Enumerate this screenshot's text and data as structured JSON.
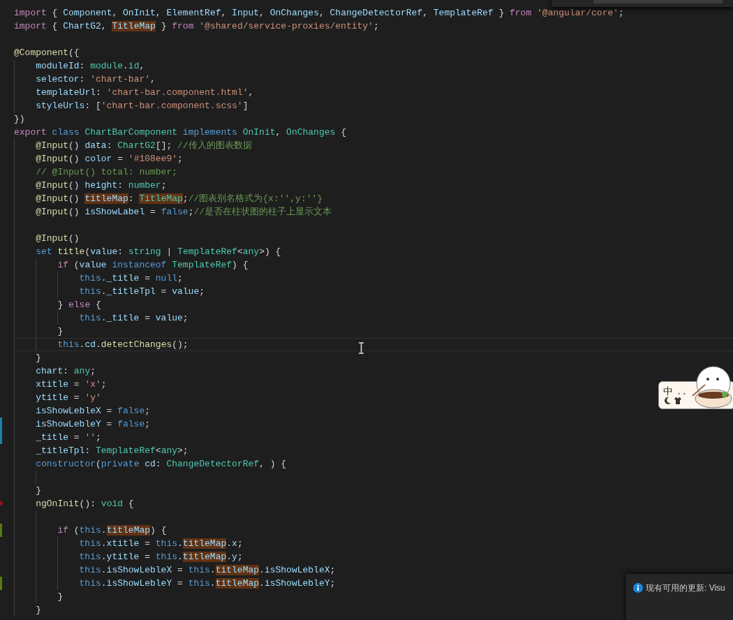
{
  "editor": {
    "lines": [
      {
        "current": false,
        "tokens": [
          {
            "text": "import",
            "kind": "keyword"
          },
          {
            "text": " { ",
            "kind": "plain"
          },
          {
            "text": "Component",
            "kind": "variable"
          },
          {
            "text": ", ",
            "kind": "plain"
          },
          {
            "text": "OnInit",
            "kind": "variable"
          },
          {
            "text": ", ",
            "kind": "plain"
          },
          {
            "text": "ElementRef",
            "kind": "variable"
          },
          {
            "text": ", ",
            "kind": "plain"
          },
          {
            "text": "Input",
            "kind": "variable"
          },
          {
            "text": ", ",
            "kind": "plain"
          },
          {
            "text": "OnChanges",
            "kind": "variable"
          },
          {
            "text": ", ",
            "kind": "plain"
          },
          {
            "text": "ChangeDetectorRef",
            "kind": "variable"
          },
          {
            "text": ", ",
            "kind": "plain"
          },
          {
            "text": "TemplateRef",
            "kind": "variable"
          },
          {
            "text": " } ",
            "kind": "plain"
          },
          {
            "text": "from ",
            "kind": "keyword"
          },
          {
            "text": "'@angular/core'",
            "kind": "string"
          },
          {
            "text": ";",
            "kind": "plain"
          }
        ]
      },
      {
        "current": false,
        "tokens": [
          {
            "text": "import",
            "kind": "keyword"
          },
          {
            "text": " { ",
            "kind": "plain"
          },
          {
            "text": "ChartG2",
            "kind": "variable"
          },
          {
            "text": ", ",
            "kind": "plain"
          },
          {
            "text": "TitleMap",
            "kind": "match"
          },
          {
            "text": " } ",
            "kind": "plain"
          },
          {
            "text": "from ",
            "kind": "keyword"
          },
          {
            "text": "'@shared/service-proxies/entity'",
            "kind": "string"
          },
          {
            "text": ";",
            "kind": "plain"
          }
        ]
      },
      {
        "current": false
      },
      {
        "current": false,
        "tokens": [
          {
            "text": "@Component",
            "kind": "function"
          },
          {
            "text": "({",
            "kind": "plain"
          }
        ],
        "children": [
          {
            "current": false,
            "tokens": [
              {
                "text": "moduleId",
                "kind": "variable"
              },
              {
                "text": ": ",
                "kind": "plain"
              },
              {
                "text": "module",
                "kind": "type"
              },
              {
                "text": ".",
                "kind": "plain"
              },
              {
                "text": "id",
                "kind": "type"
              },
              {
                "text": ",",
                "kind": "plain"
              }
            ]
          },
          {
            "current": false,
            "tokens": [
              {
                "text": "selector",
                "kind": "variable"
              },
              {
                "text": ": ",
                "kind": "plain"
              },
              {
                "text": "'chart-bar'",
                "kind": "string"
              },
              {
                "text": ",",
                "kind": "plain"
              }
            ]
          },
          {
            "current": false,
            "tokens": [
              {
                "text": "templateUrl",
                "kind": "variable"
              },
              {
                "text": ": ",
                "kind": "plain"
              },
              {
                "text": "'chart-bar.component.html'",
                "kind": "string"
              },
              {
                "text": ",",
                "kind": "plain"
              }
            ]
          },
          {
            "current": false,
            "tokens": [
              {
                "text": "styleUrls",
                "kind": "variable"
              },
              {
                "text": ": [",
                "kind": "plain"
              },
              {
                "text": "'chart-bar.component.scss'",
                "kind": "string"
              },
              {
                "text": "]",
                "kind": "plain"
              }
            ]
          }
        ]
      },
      {
        "current": false,
        "tokens": [
          {
            "text": "})",
            "kind": "plain"
          }
        ]
      },
      {
        "current": false,
        "tokens": [
          {
            "text": "export ",
            "kind": "keyword"
          },
          {
            "text": "class ",
            "kind": "storage"
          },
          {
            "text": "ChartBarComponent ",
            "kind": "type"
          },
          {
            "text": "implements ",
            "kind": "storage"
          },
          {
            "text": "OnInit",
            "kind": "type"
          },
          {
            "text": ", ",
            "kind": "plain"
          },
          {
            "text": "OnChanges",
            "kind": "type"
          },
          {
            "text": " {",
            "kind": "plain"
          }
        ],
        "children": [
          {
            "current": false,
            "tokens": [
              {
                "text": "@Input",
                "kind": "function"
              },
              {
                "text": "() ",
                "kind": "plain"
              },
              {
                "text": "data",
                "kind": "variable"
              },
              {
                "text": ": ",
                "kind": "plain"
              },
              {
                "text": "ChartG2",
                "kind": "type"
              },
              {
                "text": "[]; ",
                "kind": "plain"
              },
              {
                "text": "//传入的图表数据",
                "kind": "comment"
              }
            ]
          },
          {
            "current": false,
            "tokens": [
              {
                "text": "@Input",
                "kind": "function"
              },
              {
                "text": "() ",
                "kind": "plain"
              },
              {
                "text": "color",
                "kind": "variable"
              },
              {
                "text": " = ",
                "kind": "plain"
              },
              {
                "text": "'#108ee9'",
                "kind": "string"
              },
              {
                "text": ";",
                "kind": "plain"
              }
            ]
          },
          {
            "current": false,
            "tokens": [
              {
                "text": "// @Input() total: number;",
                "kind": "comment"
              }
            ]
          },
          {
            "current": false,
            "tokens": [
              {
                "text": "@Input",
                "kind": "function"
              },
              {
                "text": "() ",
                "kind": "plain"
              },
              {
                "text": "height",
                "kind": "variable"
              },
              {
                "text": ": ",
                "kind": "plain"
              },
              {
                "text": "number",
                "kind": "type"
              },
              {
                "text": ";",
                "kind": "plain"
              }
            ]
          },
          {
            "current": false,
            "tokens": [
              {
                "text": "@Input",
                "kind": "function"
              },
              {
                "text": "() ",
                "kind": "plain"
              },
              {
                "text": "titleMap",
                "kind": "match"
              },
              {
                "text": ": ",
                "kind": "plain"
              },
              {
                "text": "TitleMap",
                "kind": "matchtype"
              },
              {
                "text": ";",
                "kind": "plain"
              },
              {
                "text": "//图表别名格式为{x:'',y:''}",
                "kind": "comment"
              }
            ]
          },
          {
            "current": false,
            "tokens": [
              {
                "text": "@Input",
                "kind": "function"
              },
              {
                "text": "() ",
                "kind": "plain"
              },
              {
                "text": "isShowLabel",
                "kind": "variable"
              },
              {
                "text": " = ",
                "kind": "plain"
              },
              {
                "text": "false",
                "kind": "storage"
              },
              {
                "text": ";",
                "kind": "plain"
              },
              {
                "text": "//是否在柱状图的柱子上显示文本",
                "kind": "comment"
              }
            ]
          },
          {
            "current": false
          },
          {
            "current": false,
            "tokens": [
              {
                "text": "@Input",
                "kind": "function"
              },
              {
                "text": "()",
                "kind": "plain"
              }
            ]
          },
          {
            "current": false,
            "tokens": [
              {
                "text": "set ",
                "kind": "storage"
              },
              {
                "text": "title",
                "kind": "function"
              },
              {
                "text": "(",
                "kind": "plain"
              },
              {
                "text": "value",
                "kind": "variable"
              },
              {
                "text": ": ",
                "kind": "plain"
              },
              {
                "text": "string",
                "kind": "type"
              },
              {
                "text": " | ",
                "kind": "plain"
              },
              {
                "text": "TemplateRef",
                "kind": "type"
              },
              {
                "text": "<",
                "kind": "plain"
              },
              {
                "text": "any",
                "kind": "type"
              },
              {
                "text": ">) {",
                "kind": "plain"
              }
            ],
            "children": [
              {
                "current": false,
                "tokens": [
                  {
                    "text": "if",
                    "kind": "keyword"
                  },
                  {
                    "text": " (",
                    "kind": "plain"
                  },
                  {
                    "text": "value ",
                    "kind": "variable"
                  },
                  {
                    "text": "instanceof ",
                    "kind": "storage"
                  },
                  {
                    "text": "TemplateRef",
                    "kind": "type"
                  },
                  {
                    "text": ") {",
                    "kind": "plain"
                  }
                ],
                "children": [
                  {
                    "current": false,
                    "tokens": [
                      {
                        "text": "this",
                        "kind": "storage"
                      },
                      {
                        "text": ".",
                        "kind": "plain"
                      },
                      {
                        "text": "_title",
                        "kind": "variable"
                      },
                      {
                        "text": " = ",
                        "kind": "plain"
                      },
                      {
                        "text": "null",
                        "kind": "storage"
                      },
                      {
                        "text": ";",
                        "kind": "plain"
                      }
                    ]
                  },
                  {
                    "current": false,
                    "tokens": [
                      {
                        "text": "this",
                        "kind": "storage"
                      },
                      {
                        "text": ".",
                        "kind": "plain"
                      },
                      {
                        "text": "_titleTpl",
                        "kind": "variable"
                      },
                      {
                        "text": " = ",
                        "kind": "plain"
                      },
                      {
                        "text": "value",
                        "kind": "variable"
                      },
                      {
                        "text": ";",
                        "kind": "plain"
                      }
                    ]
                  }
                ]
              },
              {
                "current": false,
                "tokens": [
                  {
                    "text": "} ",
                    "kind": "plain"
                  },
                  {
                    "text": "else",
                    "kind": "keyword"
                  },
                  {
                    "text": " {",
                    "kind": "plain"
                  }
                ],
                "children": [
                  {
                    "current": false,
                    "tokens": [
                      {
                        "text": "this",
                        "kind": "storage"
                      },
                      {
                        "text": ".",
                        "kind": "plain"
                      },
                      {
                        "text": "_title",
                        "kind": "variable"
                      },
                      {
                        "text": " = ",
                        "kind": "plain"
                      },
                      {
                        "text": "value",
                        "kind": "variable"
                      },
                      {
                        "text": ";",
                        "kind": "plain"
                      }
                    ]
                  }
                ]
              },
              {
                "current": false,
                "tokens": [
                  {
                    "text": "}",
                    "kind": "plain"
                  }
                ]
              },
              {
                "current": true,
                "tokens": [
                  {
                    "text": "this",
                    "kind": "storage"
                  },
                  {
                    "text": ".",
                    "kind": "plain"
                  },
                  {
                    "text": "cd",
                    "kind": "variable"
                  },
                  {
                    "text": ".",
                    "kind": "plain"
                  },
                  {
                    "text": "detectChanges",
                    "kind": "function"
                  },
                  {
                    "text": "();",
                    "kind": "plain"
                  }
                ]
              }
            ]
          },
          {
            "current": false,
            "tokens": [
              {
                "text": "}",
                "kind": "plain"
              }
            ]
          },
          {
            "current": false,
            "tokens": [
              {
                "text": "chart",
                "kind": "variable"
              },
              {
                "text": ": ",
                "kind": "plain"
              },
              {
                "text": "any",
                "kind": "type"
              },
              {
                "text": ";",
                "kind": "plain"
              }
            ]
          },
          {
            "current": false,
            "tokens": [
              {
                "text": "xtitle",
                "kind": "variable"
              },
              {
                "text": " = ",
                "kind": "plain"
              },
              {
                "text": "'x'",
                "kind": "string"
              },
              {
                "text": ";",
                "kind": "plain"
              }
            ]
          },
          {
            "current": false,
            "tokens": [
              {
                "text": "ytitle",
                "kind": "variable"
              },
              {
                "text": " = ",
                "kind": "plain"
              },
              {
                "text": "'y'",
                "kind": "string"
              }
            ]
          },
          {
            "current": false,
            "tokens": [
              {
                "text": "isShowLebleX",
                "kind": "variable"
              },
              {
                "text": " = ",
                "kind": "plain"
              },
              {
                "text": "false",
                "kind": "storage"
              },
              {
                "text": ";",
                "kind": "plain"
              }
            ]
          },
          {
            "gutter": {
              "kind": "modified"
            },
            "current": false,
            "tokens": [
              {
                "text": "isShowLebleY",
                "kind": "variable"
              },
              {
                "text": " = ",
                "kind": "plain"
              },
              {
                "text": "false",
                "kind": "storage"
              },
              {
                "text": ";",
                "kind": "plain"
              }
            ]
          },
          {
            "gutter": {
              "kind": "modified"
            },
            "current": false,
            "tokens": [
              {
                "text": "_title",
                "kind": "variable"
              },
              {
                "text": " = ",
                "kind": "plain"
              },
              {
                "text": "''",
                "kind": "string"
              },
              {
                "text": ";",
                "kind": "plain"
              }
            ]
          },
          {
            "current": false,
            "tokens": [
              {
                "text": "_titleTpl",
                "kind": "variable"
              },
              {
                "text": ": ",
                "kind": "plain"
              },
              {
                "text": "TemplateRef",
                "kind": "type"
              },
              {
                "text": "<",
                "kind": "plain"
              },
              {
                "text": "any",
                "kind": "type"
              },
              {
                "text": ">;",
                "kind": "plain"
              }
            ]
          },
          {
            "current": false,
            "tokens": [
              {
                "text": "constructor",
                "kind": "storage"
              },
              {
                "text": "(",
                "kind": "plain"
              },
              {
                "text": "private ",
                "kind": "storage"
              },
              {
                "text": "cd",
                "kind": "variable"
              },
              {
                "text": ": ",
                "kind": "plain"
              },
              {
                "text": "ChangeDetectorRef",
                "kind": "type"
              },
              {
                "text": ", ) {",
                "kind": "plain"
              }
            ],
            "children": [
              {
                "current": false
              }
            ]
          },
          {
            "current": false,
            "tokens": [
              {
                "text": "}",
                "kind": "plain"
              }
            ]
          },
          {
            "gutter": {
              "kind": "deleted"
            },
            "current": false,
            "tokens": [
              {
                "text": "ngOnInit",
                "kind": "function"
              },
              {
                "text": "(): ",
                "kind": "plain"
              },
              {
                "text": "void",
                "kind": "type"
              },
              {
                "text": " {",
                "kind": "plain"
              }
            ],
            "children": [
              {
                "current": false
              },
              {
                "gutter": {
                  "kind": "added"
                },
                "current": false,
                "tokens": [
                  {
                    "text": "if",
                    "kind": "keyword"
                  },
                  {
                    "text": " (",
                    "kind": "plain"
                  },
                  {
                    "text": "this",
                    "kind": "storage"
                  },
                  {
                    "text": ".",
                    "kind": "plain"
                  },
                  {
                    "text": "titleMap",
                    "kind": "match"
                  },
                  {
                    "text": ") {",
                    "kind": "plain"
                  }
                ],
                "children": [
                  {
                    "current": false,
                    "tokens": [
                      {
                        "text": "this",
                        "kind": "storage"
                      },
                      {
                        "text": ".",
                        "kind": "plain"
                      },
                      {
                        "text": "xtitle",
                        "kind": "variable"
                      },
                      {
                        "text": " = ",
                        "kind": "plain"
                      },
                      {
                        "text": "this",
                        "kind": "storage"
                      },
                      {
                        "text": ".",
                        "kind": "plain"
                      },
                      {
                        "text": "titleMap",
                        "kind": "match"
                      },
                      {
                        "text": ".",
                        "kind": "plain"
                      },
                      {
                        "text": "x",
                        "kind": "variable"
                      },
                      {
                        "text": ";",
                        "kind": "plain"
                      }
                    ]
                  },
                  {
                    "current": false,
                    "tokens": [
                      {
                        "text": "this",
                        "kind": "storage"
                      },
                      {
                        "text": ".",
                        "kind": "plain"
                      },
                      {
                        "text": "ytitle",
                        "kind": "variable"
                      },
                      {
                        "text": " = ",
                        "kind": "plain"
                      },
                      {
                        "text": "this",
                        "kind": "storage"
                      },
                      {
                        "text": ".",
                        "kind": "plain"
                      },
                      {
                        "text": "titleMap",
                        "kind": "match"
                      },
                      {
                        "text": ".",
                        "kind": "plain"
                      },
                      {
                        "text": "y",
                        "kind": "variable"
                      },
                      {
                        "text": ";",
                        "kind": "plain"
                      }
                    ]
                  },
                  {
                    "current": false,
                    "tokens": [
                      {
                        "text": "this",
                        "kind": "storage"
                      },
                      {
                        "text": ".",
                        "kind": "plain"
                      },
                      {
                        "text": "isShowLebleX",
                        "kind": "variable"
                      },
                      {
                        "text": " = ",
                        "kind": "plain"
                      },
                      {
                        "text": "this",
                        "kind": "storage"
                      },
                      {
                        "text": ".",
                        "kind": "plain"
                      },
                      {
                        "text": "titleMap",
                        "kind": "match"
                      },
                      {
                        "text": ".",
                        "kind": "plain"
                      },
                      {
                        "text": "isShowLebleX",
                        "kind": "variable"
                      },
                      {
                        "text": ";",
                        "kind": "plain"
                      }
                    ]
                  },
                  {
                    "gutter": {
                      "kind": "added"
                    },
                    "current": false,
                    "tokens": [
                      {
                        "text": "this",
                        "kind": "storage"
                      },
                      {
                        "text": ".",
                        "kind": "plain"
                      },
                      {
                        "text": "isShowLebleY",
                        "kind": "variable"
                      },
                      {
                        "text": " = ",
                        "kind": "plain"
                      },
                      {
                        "text": "this",
                        "kind": "storage"
                      },
                      {
                        "text": ".",
                        "kind": "plain"
                      },
                      {
                        "text": "titleMap",
                        "kind": "match"
                      },
                      {
                        "text": ".",
                        "kind": "plain"
                      },
                      {
                        "text": "isShowLebleY",
                        "kind": "variable"
                      },
                      {
                        "text": ";",
                        "kind": "plain"
                      }
                    ]
                  }
                ]
              },
              {
                "current": false,
                "tokens": [
                  {
                    "text": "}",
                    "kind": "plain"
                  }
                ]
              }
            ]
          },
          {
            "current": false,
            "tokens": [
              {
                "text": "}",
                "kind": "plain"
              }
            ]
          }
        ]
      }
    ]
  },
  "ime_toolbar": {
    "mode": "中",
    "punctuation": "，。"
  },
  "notification": {
    "message": "现有可用的更新: Visu"
  }
}
